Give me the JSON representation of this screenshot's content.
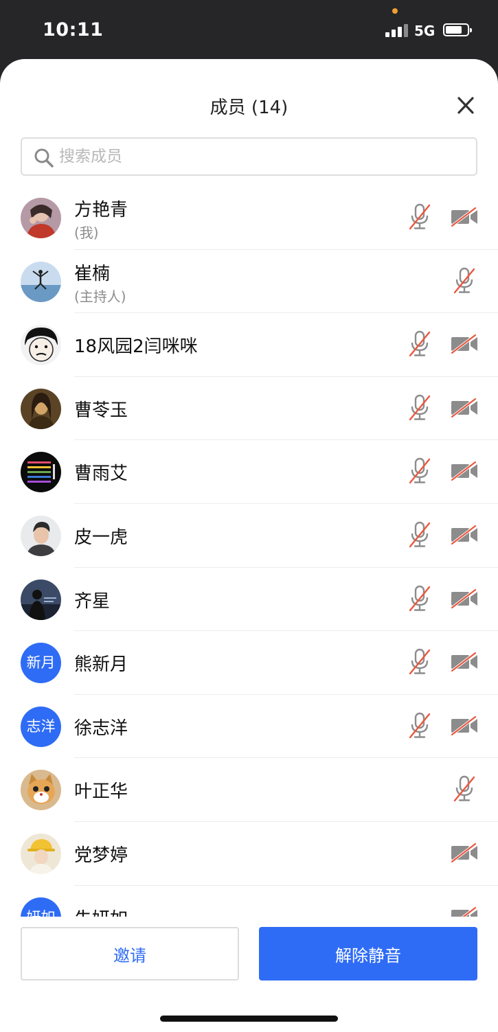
{
  "status_bar": {
    "time": "10:11",
    "network": "5G"
  },
  "header": {
    "title": "成员 (14)"
  },
  "search": {
    "placeholder": "搜索成员"
  },
  "members": [
    {
      "name": "方艳青",
      "role": "(我)",
      "avatar_type": "photo",
      "avatar_desc": "woman-portrait",
      "mic_muted": true,
      "camera_off": true
    },
    {
      "name": "崔楠",
      "role": "(主持人)",
      "avatar_type": "photo",
      "avatar_desc": "person-jumping-beach",
      "mic_muted": true,
      "camera_off": false
    },
    {
      "name": "18风园2闫咪咪",
      "role": "",
      "avatar_type": "photo",
      "avatar_desc": "cartoon-face",
      "mic_muted": true,
      "camera_off": true
    },
    {
      "name": "曹苓玉",
      "role": "",
      "avatar_type": "photo",
      "avatar_desc": "mona-lisa",
      "mic_muted": true,
      "camera_off": true
    },
    {
      "name": "曹雨艾",
      "role": "",
      "avatar_type": "photo",
      "avatar_desc": "colorful-stripes-dark",
      "mic_muted": true,
      "camera_off": true
    },
    {
      "name": "皮一虎",
      "role": "",
      "avatar_type": "photo",
      "avatar_desc": "young-man-portrait",
      "mic_muted": true,
      "camera_off": true
    },
    {
      "name": "齐星",
      "role": "",
      "avatar_type": "photo",
      "avatar_desc": "silhouette-dark",
      "mic_muted": true,
      "camera_off": true
    },
    {
      "name": "熊新月",
      "role": "",
      "avatar_type": "text",
      "avatar_text": "新月",
      "mic_muted": true,
      "camera_off": true
    },
    {
      "name": "徐志洋",
      "role": "",
      "avatar_type": "text",
      "avatar_text": "志洋",
      "mic_muted": true,
      "camera_off": true
    },
    {
      "name": "叶正华",
      "role": "",
      "avatar_type": "photo",
      "avatar_desc": "cat-face",
      "mic_muted": true,
      "camera_off": false
    },
    {
      "name": "党梦婷",
      "role": "",
      "avatar_type": "photo",
      "avatar_desc": "girl-yellow-hat",
      "mic_muted": false,
      "camera_off": true
    },
    {
      "name": "朱妍如",
      "role": "",
      "avatar_type": "text",
      "avatar_text": "妍如",
      "mic_muted": false,
      "camera_off": true
    }
  ],
  "footer": {
    "invite_label": "邀请",
    "unmute_label": "解除静音"
  },
  "colors": {
    "accent": "#2f6cf5",
    "muted_slash": "#e9573f",
    "icon_gray": "#8c8c8c"
  }
}
